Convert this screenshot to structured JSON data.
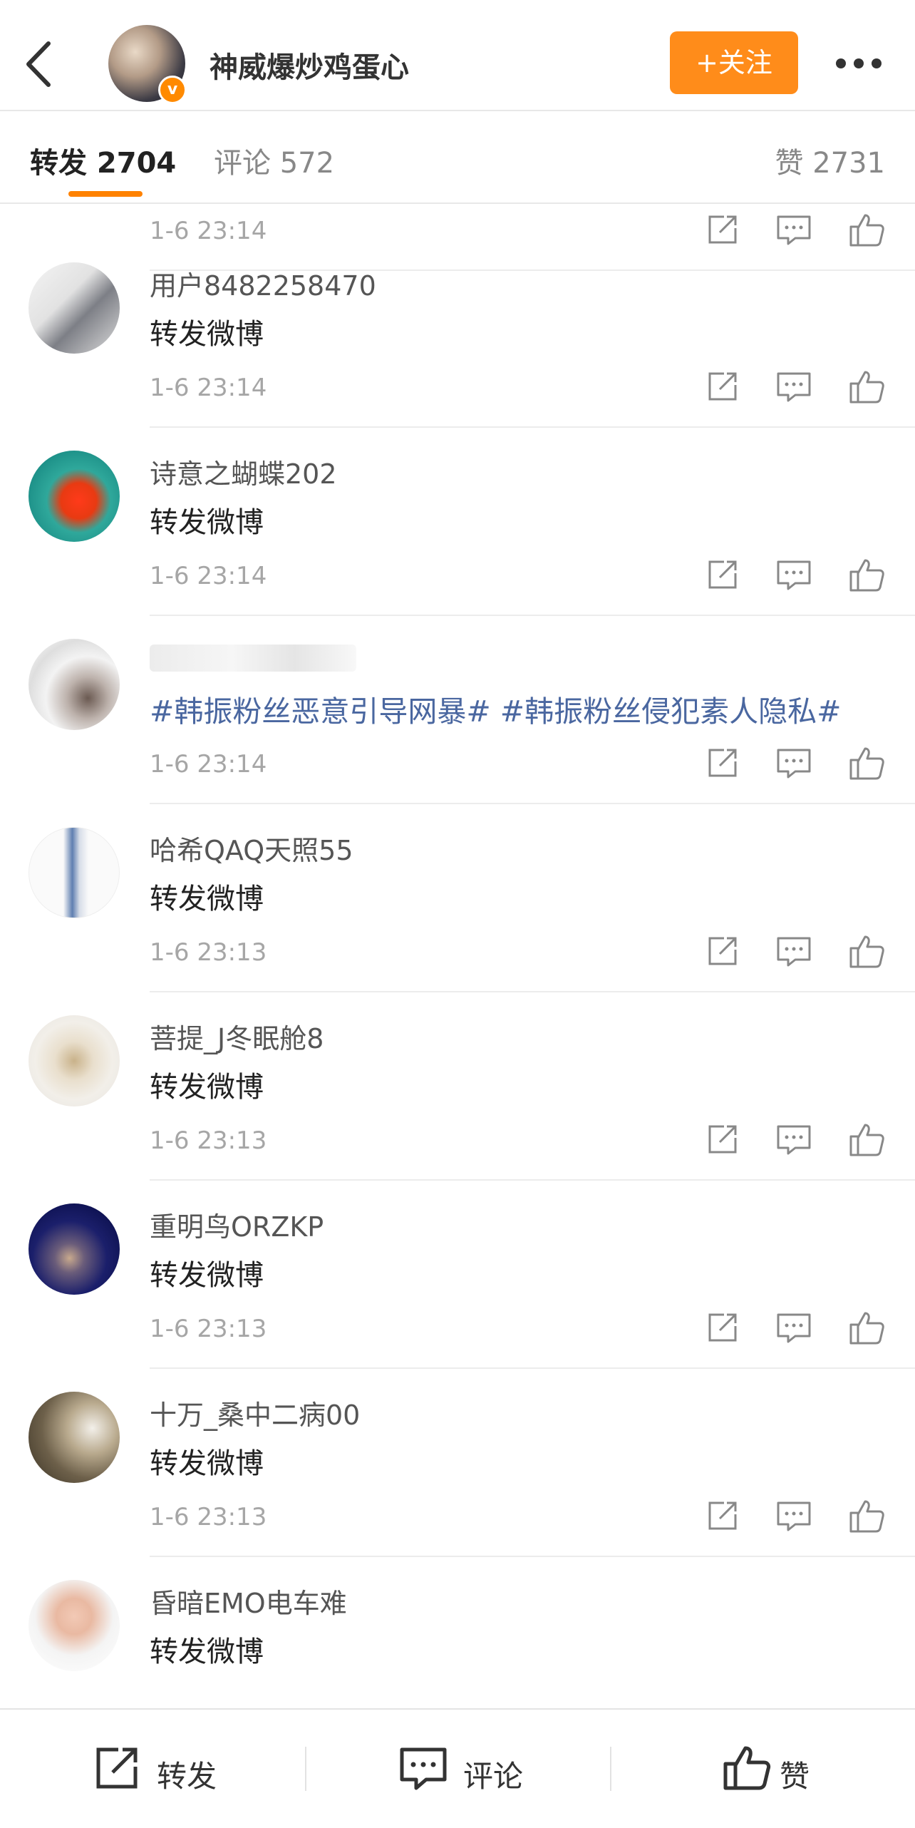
{
  "header": {
    "title": "神威爆炒鸡蛋心",
    "follow_label": "+关注"
  },
  "tabs": {
    "repost": "转发 2704",
    "comment": "评论 572",
    "like": "赞 2731"
  },
  "items": [
    {
      "username": "",
      "content": "",
      "time": "1-6 23:14"
    },
    {
      "username": "用户8482258470",
      "content": "转发微博",
      "time": "1-6 23:14"
    },
    {
      "username": "诗意之蝴蝶202",
      "content": "转发微博",
      "time": "1-6 23:14"
    },
    {
      "username": "",
      "content": "#韩振粉丝恶意引导网暴# #韩振粉丝侵犯素人隐私#",
      "time": "1-6 23:14"
    },
    {
      "username": "哈希QAQ天照55",
      "content": "转发微博",
      "time": "1-6 23:13"
    },
    {
      "username": "菩提_J冬眠舱8",
      "content": "转发微博",
      "time": "1-6 23:13"
    },
    {
      "username": "重明鸟ORZKP",
      "content": "转发微博",
      "time": "1-6 23:13"
    },
    {
      "username": "十万_桑中二病00",
      "content": "转发微博",
      "time": "1-6 23:13"
    },
    {
      "username": "昏暗EMO电车难",
      "content": "转发微博",
      "time": "1-6 23:13"
    }
  ],
  "toolbar": {
    "repost": "转发",
    "comment": "评论",
    "like": "赞"
  },
  "colors": {
    "accent": "#ff8200",
    "topic_link": "#4a67a0",
    "time_text": "#a6a6a6"
  }
}
